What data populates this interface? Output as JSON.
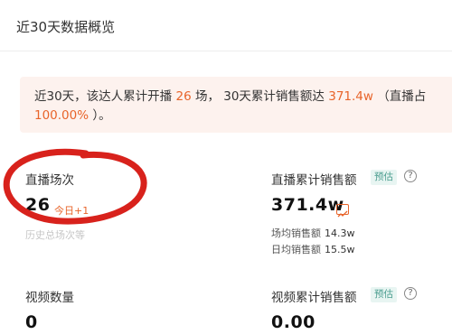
{
  "header": {
    "title": "近30天数据概览"
  },
  "notice": {
    "part1": "近30天，该达人累计开播 ",
    "sessions": "26",
    "part2": " 场， 30天累计销售额达 ",
    "sales": "371.4w",
    "part3": " （直播占",
    "live_share": "100.00%",
    "part4": " ）。"
  },
  "stats": {
    "live_sessions": {
      "label": "直播场次",
      "value": "26",
      "delta": "今日+1",
      "faded_text": "历史总场次等"
    },
    "live_sales": {
      "label": "直播累计销售额",
      "badge": "预估",
      "value": "371.4w",
      "avg_session_label": "场均销售额",
      "avg_session_value": "14.3w",
      "avg_day_label": "日均销售额",
      "avg_day_value": "15.5w"
    },
    "video_count": {
      "label": "视频数量",
      "value": "0"
    },
    "video_sales": {
      "label": "视频累计销售额",
      "badge": "预估",
      "value": "0.00"
    }
  },
  "icons": {
    "help": "help-circle-icon",
    "trend": "trend-chart-icon"
  },
  "colors": {
    "accent": "#e8642a",
    "badge_text": "#4a9d8f",
    "badge_bg": "#e8f5f2",
    "annotation_red": "#d8221c"
  }
}
